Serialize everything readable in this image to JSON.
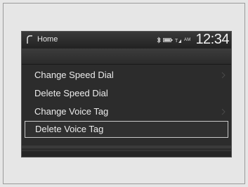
{
  "header": {
    "home_label": "Home",
    "clock": "12:34",
    "am_label": "AM",
    "icons": [
      "bluetooth-icon",
      "battery-icon",
      "signal-icon"
    ]
  },
  "menu": {
    "items": [
      {
        "label": "Change Speed Dial",
        "has_submenu": true
      },
      {
        "label": "Delete Speed Dial",
        "has_submenu": false
      },
      {
        "label": "Change Voice Tag",
        "has_submenu": true
      },
      {
        "label": "Delete Voice Tag",
        "has_submenu": false,
        "selected": true
      }
    ]
  },
  "colors": {
    "screen_bg": "#2c2c2c",
    "text": "#ececec",
    "selection_border": "#c9c9c9",
    "page_bg": "#e6e6e6"
  }
}
